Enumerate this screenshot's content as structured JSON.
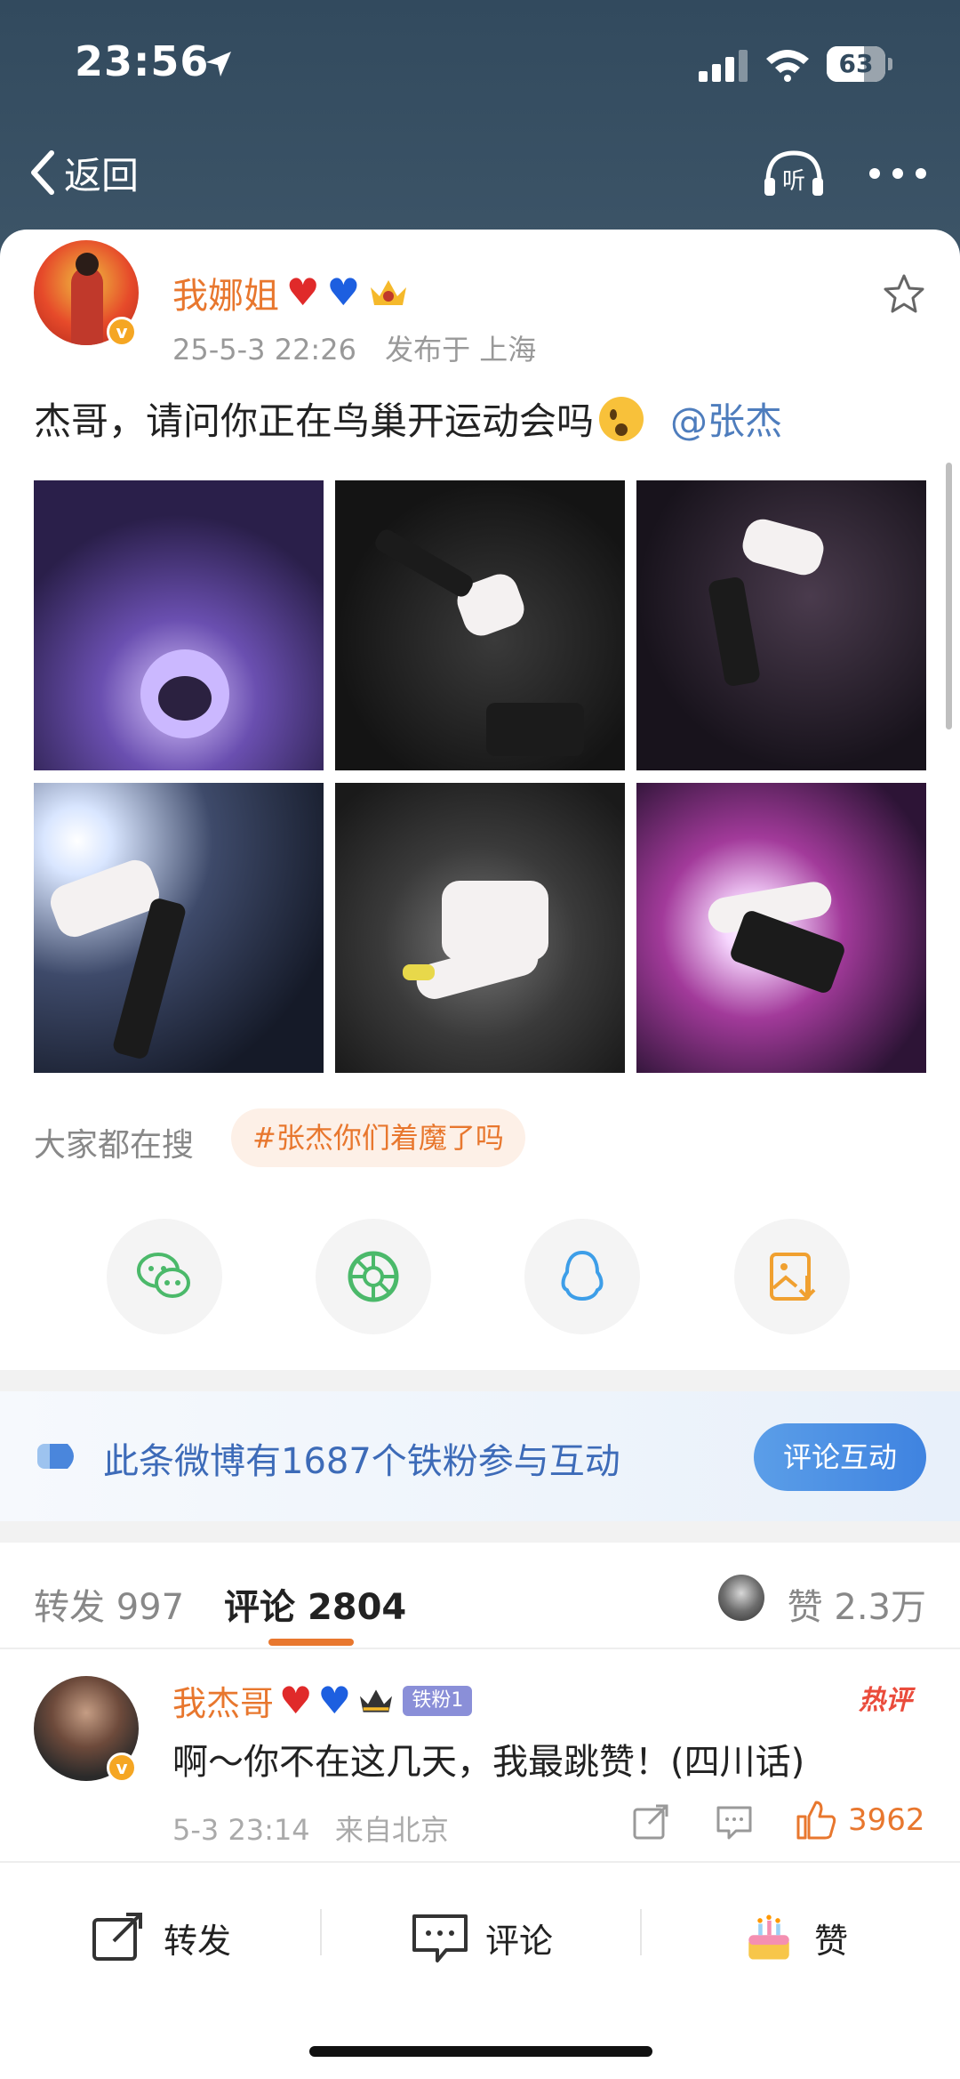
{
  "status_bar": {
    "time": "23:56",
    "battery": "63"
  },
  "nav": {
    "back_label": "返回",
    "listen_icon": "listen-icon",
    "more_icon": "more-icon"
  },
  "post": {
    "author": "我娜姐",
    "timestamp": "25-5-3 22:26",
    "location": "发布于 上海",
    "text": "杰哥，请问你正在鸟巢开运动会吗",
    "mention": "@张杰",
    "photo_count": 6,
    "search_label": "大家都在搜",
    "topic": "#张杰你们着魔了吗"
  },
  "share_targets": [
    "wechat-icon",
    "moments-icon",
    "qq-icon",
    "save-image-icon"
  ],
  "fan_banner": {
    "text": "此条微博有1687个铁粉参与互动",
    "button": "评论互动"
  },
  "tabs": {
    "repost_label": "转发",
    "repost_count": "997",
    "comment_label": "评论",
    "comment_count": "2804",
    "like_label": "赞",
    "like_count": "2.3万"
  },
  "comment": {
    "author": "我杰哥",
    "fan_badge": "铁粉1",
    "hot_tag": "热评",
    "text": "啊～你不在这几天，我最跳赞！(四川话)",
    "timestamp": "5-3 23:14",
    "location": "来自北京",
    "likes": "3962"
  },
  "bottom_bar": {
    "repost": "转发",
    "comment": "评论",
    "like": "赞"
  },
  "colors": {
    "accent": "#e8772e",
    "link": "#4e7dbd",
    "header_bg": "#324a5e",
    "fan_blue": "#3d6bb8"
  }
}
